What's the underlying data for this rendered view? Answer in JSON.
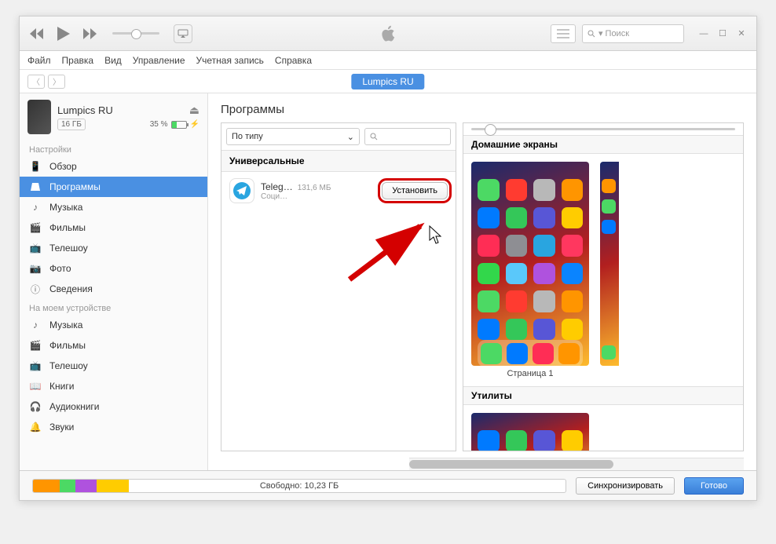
{
  "menubar": [
    "Файл",
    "Правка",
    "Вид",
    "Управление",
    "Учетная запись",
    "Справка"
  ],
  "search": {
    "placeholder": "Поиск"
  },
  "device": {
    "tab": "Lumpics RU",
    "name": "Lumpics RU",
    "storage": "16 ГБ",
    "battery": "35 %"
  },
  "sidebar": {
    "settings_label": "Настройки",
    "settings": [
      "Обзор",
      "Программы",
      "Музыка",
      "Фильмы",
      "Телешоу",
      "Фото",
      "Сведения"
    ],
    "ondevice_label": "На моем устройстве",
    "ondevice": [
      "Музыка",
      "Фильмы",
      "Телешоу",
      "Книги",
      "Аудиокниги",
      "Звуки"
    ]
  },
  "content": {
    "title": "Программы",
    "sort": "По типу",
    "category": "Универсальные",
    "app": {
      "name": "Teleg…",
      "size": "131,6 МБ",
      "category": "Соци…",
      "install": "Установить"
    },
    "screens_label": "Домашние экраны",
    "page1": "Страница 1",
    "utilities_label": "Утилиты"
  },
  "footer": {
    "free": "Свободно: 10,23 ГБ",
    "sync": "Синхронизировать",
    "done": "Готово"
  },
  "colors": {
    "tiles": [
      "#4cd964",
      "#ff3b30",
      "#b8b8b8",
      "#ff9500",
      "#007aff",
      "#34c759",
      "#5856d6",
      "#ffcc00",
      "#ff2d55",
      "#8e8e93",
      "#29a5e0",
      "#ff375f",
      "#32d74b",
      "#5ac8fa",
      "#af52de",
      "#0a84ff"
    ]
  }
}
